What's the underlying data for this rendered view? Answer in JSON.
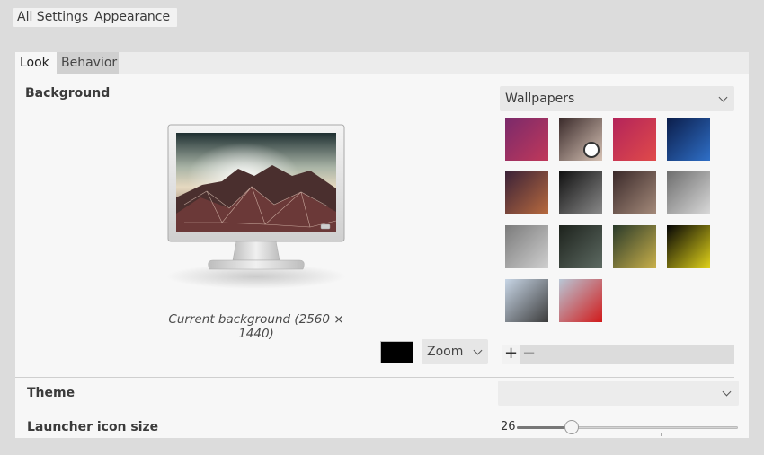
{
  "breadcrumbs": [
    "All Settings",
    "Appearance"
  ],
  "tabs": [
    {
      "label": "Look",
      "active": true
    },
    {
      "label": "Behavior",
      "active": false
    }
  ],
  "background": {
    "title": "Background",
    "caption": "Current background (2560 × 1440)",
    "color": "#000000",
    "fill_mode": "Zoom",
    "source": "Wallpapers",
    "thumbnails": [
      {
        "name": "purple-gradient-wallpaper",
        "colors": [
          "#7a2a6b",
          "#c0385a"
        ]
      },
      {
        "name": "glass-orb-clock-wallpaper",
        "colors": [
          "#3a2a2a",
          "#d6c2b5"
        ]
      },
      {
        "name": "magenta-red-wallpaper",
        "colors": [
          "#b3245a",
          "#e04a4a"
        ]
      },
      {
        "name": "blue-planet-wallpaper",
        "colors": [
          "#0b1d4a",
          "#2f6fc7"
        ]
      },
      {
        "name": "night-sky-wallpaper",
        "colors": [
          "#3b2238",
          "#b86a3e"
        ]
      },
      {
        "name": "clock-wallpaper",
        "colors": [
          "#111111",
          "#8a8a8a"
        ]
      },
      {
        "name": "glass-orbs-wallpaper",
        "colors": [
          "#3b2a2a",
          "#a48a7a"
        ]
      },
      {
        "name": "frosty-grass-wallpaper",
        "colors": [
          "#6e6e6e",
          "#d9d9d9"
        ]
      },
      {
        "name": "ice-crystals-wallpaper",
        "colors": [
          "#7b7b7b",
          "#cfcfcf"
        ]
      },
      {
        "name": "dark-pebbles-wallpaper",
        "colors": [
          "#1d221c",
          "#5d6a62"
        ]
      },
      {
        "name": "bee-flower-wallpaper",
        "colors": [
          "#2a3a2a",
          "#c9b04a"
        ]
      },
      {
        "name": "yellow-flower-wallpaper",
        "colors": [
          "#050505",
          "#e0d21a"
        ]
      },
      {
        "name": "misty-trees-wallpaper",
        "colors": [
          "#c8d6e6",
          "#3c3c3c"
        ]
      },
      {
        "name": "red-poppies-wallpaper",
        "colors": [
          "#b9c7d6",
          "#d11a1a"
        ]
      }
    ]
  },
  "theme": {
    "title": "Theme",
    "value": ""
  },
  "launcher": {
    "title": "Launcher icon size",
    "value_label": "26",
    "fraction": 0.23
  }
}
